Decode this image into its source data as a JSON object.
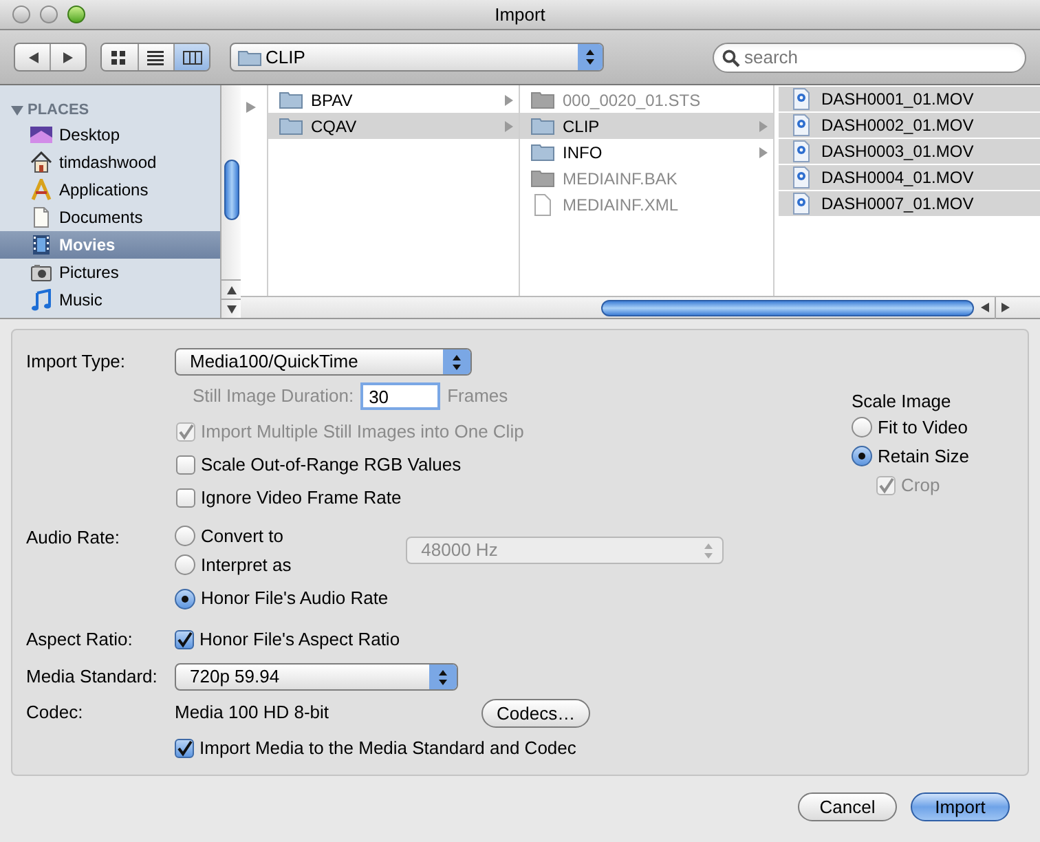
{
  "window": {
    "title": "Import"
  },
  "toolbar": {
    "view_modes": [
      {
        "kind": "icons",
        "selected": false
      },
      {
        "kind": "list",
        "selected": false
      },
      {
        "kind": "columns",
        "selected": true
      }
    ],
    "path": "CLIP",
    "search": {
      "placeholder": "search"
    }
  },
  "sidebar": {
    "heading": "PLACES",
    "expanded": true,
    "items": [
      {
        "label": "Desktop",
        "kind": "desktop",
        "selected": false
      },
      {
        "label": "timdashwood",
        "kind": "home",
        "selected": false
      },
      {
        "label": "Applications",
        "kind": "applications",
        "selected": false
      },
      {
        "label": "Documents",
        "kind": "documents",
        "selected": false
      },
      {
        "label": "Movies",
        "kind": "movies",
        "selected": true
      },
      {
        "label": "Pictures",
        "kind": "pictures",
        "selected": false
      },
      {
        "label": "Music",
        "kind": "music",
        "selected": false
      }
    ]
  },
  "columns": [
    {
      "items": [
        {
          "name": "BPAV",
          "kind": "folder",
          "selected": false,
          "disabled": false
        },
        {
          "name": "CQAV",
          "kind": "folder",
          "selected": true,
          "disabled": false
        }
      ]
    },
    {
      "items": [
        {
          "name": "000_0020_01.STS",
          "kind": "file",
          "selected": false,
          "disabled": true
        },
        {
          "name": "CLIP",
          "kind": "folder",
          "selected": true,
          "disabled": false
        },
        {
          "name": "INFO",
          "kind": "folder",
          "selected": false,
          "disabled": false
        },
        {
          "name": "MEDIAINF.BAK",
          "kind": "file",
          "selected": false,
          "disabled": true
        },
        {
          "name": "MEDIAINF.XML",
          "kind": "document",
          "selected": false,
          "disabled": true
        }
      ]
    },
    {
      "items": [
        {
          "name": "DASH0001_01.MOV",
          "kind": "movie",
          "selected": true,
          "disabled": false
        },
        {
          "name": "DASH0002_01.MOV",
          "kind": "movie",
          "selected": true,
          "disabled": false
        },
        {
          "name": "DASH0003_01.MOV",
          "kind": "movie",
          "selected": true,
          "disabled": false
        },
        {
          "name": "DASH0004_01.MOV",
          "kind": "movie",
          "selected": true,
          "disabled": false
        },
        {
          "name": "DASH0007_01.MOV",
          "kind": "movie",
          "selected": true,
          "disabled": false
        }
      ]
    }
  ],
  "import_type": {
    "label": "Import Type:",
    "value": "Media100/QuickTime"
  },
  "still_duration": {
    "label": "Still Image Duration:",
    "value": "30",
    "unit": "Frames",
    "disabled": true
  },
  "options": [
    {
      "label": "Import Multiple Still Images into One Clip",
      "checked": true,
      "disabled": true
    },
    {
      "label": "Scale Out-of-Range RGB Values",
      "checked": false,
      "disabled": false
    },
    {
      "label": "Ignore Video Frame Rate",
      "checked": false,
      "disabled": false
    }
  ],
  "scale_image": {
    "title": "Scale Image",
    "options": [
      {
        "label": "Fit to Video",
        "selected": false
      },
      {
        "label": "Retain Size",
        "selected": true
      }
    ],
    "crop": {
      "label": "Crop",
      "checked": true,
      "disabled": true
    }
  },
  "audio_rate": {
    "label": "Audio Rate:",
    "options": [
      {
        "label": "Convert to",
        "selected": false
      },
      {
        "label": "Interpret as",
        "selected": false
      },
      {
        "label": "Honor File's Audio Rate",
        "selected": true
      }
    ],
    "rate": {
      "value": "48000 Hz",
      "disabled": true
    }
  },
  "aspect_ratio": {
    "label": "Aspect Ratio:",
    "checkbox": {
      "label": "Honor File's Aspect Ratio",
      "checked": true,
      "disabled": false
    }
  },
  "media_standard": {
    "label": "Media Standard:",
    "value": "720p 59.94"
  },
  "codec": {
    "label": "Codec:",
    "value": "Media 100 HD 8-bit",
    "button": "Codecs…"
  },
  "import_media": {
    "label": "Import Media to the Media Standard and Codec",
    "checked": true,
    "disabled": false
  },
  "buttons": [
    {
      "label": "Cancel",
      "default": false
    },
    {
      "label": "Import",
      "default": true
    }
  ]
}
